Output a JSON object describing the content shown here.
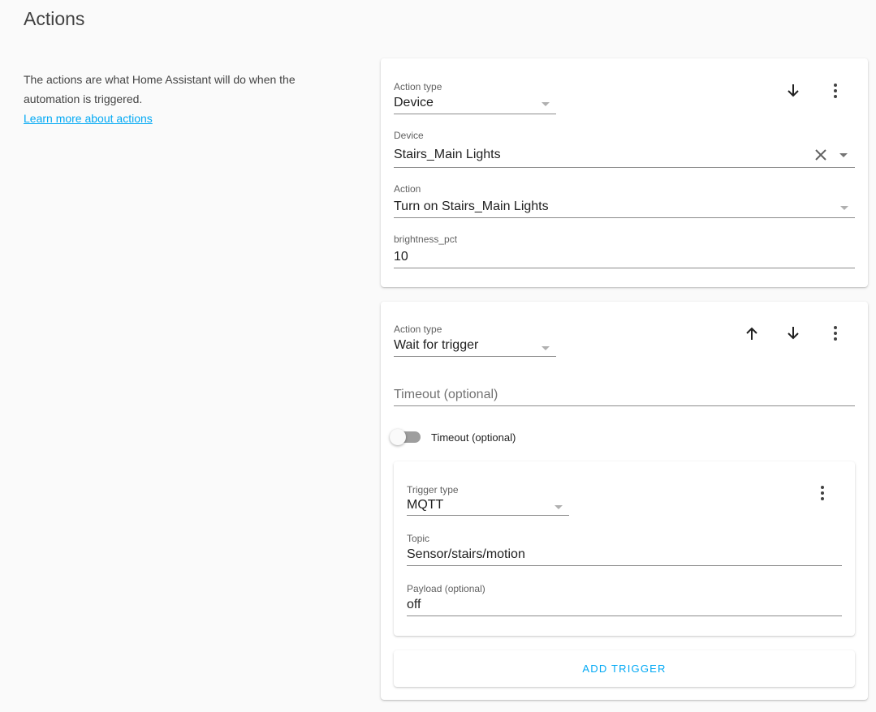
{
  "page": {
    "title": "Actions",
    "intro_text": "The actions are what Home Assistant will do when the automation is triggered.",
    "learn_more_link": "Learn more about actions"
  },
  "action1": {
    "action_type_label": "Action type",
    "action_type_value": "Device",
    "device_label": "Device",
    "device_value": "Stairs_Main Lights",
    "action_label": "Action",
    "action_value": "Turn on Stairs_Main Lights",
    "brightness_label": "brightness_pct",
    "brightness_value": "10",
    "icons": [
      "arrow-down-icon",
      "more-vert-icon",
      "clear-icon",
      "dropdown-caret-icon"
    ]
  },
  "action2": {
    "action_type_label": "Action type",
    "action_type_value": "Wait for trigger",
    "timeout_placeholder": "Timeout (optional)",
    "toggle_label": "Timeout (optional)",
    "toggle_on": false,
    "icons": [
      "arrow-up-icon",
      "arrow-down-icon",
      "more-vert-icon"
    ],
    "trigger": {
      "trigger_type_label": "Trigger type",
      "trigger_type_value": "MQTT",
      "topic_label": "Topic",
      "topic_value": "Sensor/stairs/motion",
      "payload_label": "Payload (optional)",
      "payload_value": "off",
      "icons": [
        "more-vert-icon"
      ]
    },
    "add_trigger_label": "ADD TRIGGER"
  },
  "colors": {
    "accent": "#03a9f4",
    "background": "#fafafa",
    "card": "#ffffff"
  }
}
